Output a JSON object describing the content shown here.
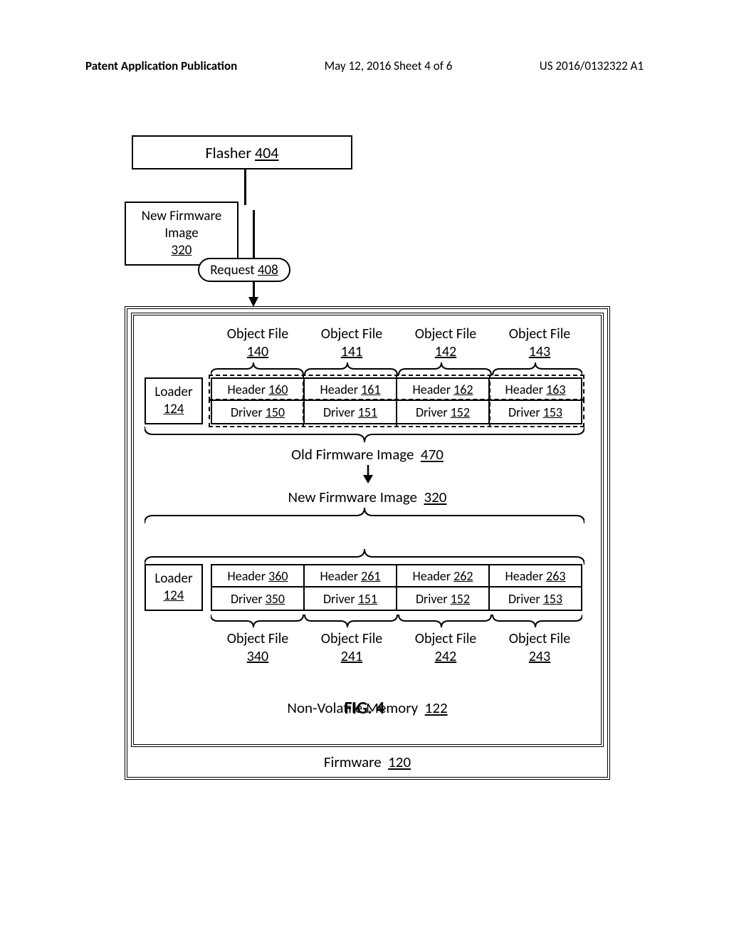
{
  "header": {
    "pub_type": "Patent Application Publication",
    "date_sheet": "May 12, 2016  Sheet 4 of 6",
    "pub_no": "US 2016/0132322 A1"
  },
  "figure_label": "FIG. 4",
  "flasher": {
    "name": "Flasher",
    "ref": "404"
  },
  "new_fw_box": {
    "line1": "New Firmware",
    "line2": "Image",
    "ref": "320"
  },
  "request": {
    "name": "Request",
    "ref": "408"
  },
  "firmware": {
    "name": "Firmware",
    "ref": "120"
  },
  "nvmem": {
    "name": "Non-Volatile Memory",
    "ref": "122"
  },
  "object_files_top": [
    {
      "label": "Object File",
      "ref": "140"
    },
    {
      "label": "Object File",
      "ref": "141"
    },
    {
      "label": "Object File",
      "ref": "142"
    },
    {
      "label": "Object File",
      "ref": "143"
    }
  ],
  "loader": {
    "name": "Loader",
    "ref": "124"
  },
  "old_table": {
    "headers": [
      {
        "label": "Header",
        "ref": "160"
      },
      {
        "label": "Header",
        "ref": "161"
      },
      {
        "label": "Header",
        "ref": "162"
      },
      {
        "label": "Header",
        "ref": "163"
      }
    ],
    "drivers": [
      {
        "label": "Driver",
        "ref": "150"
      },
      {
        "label": "Driver",
        "ref": "151"
      },
      {
        "label": "Driver",
        "ref": "152"
      },
      {
        "label": "Driver",
        "ref": "153"
      }
    ]
  },
  "old_image": {
    "name": "Old Firmware Image",
    "ref": "470"
  },
  "new_image": {
    "name": "New Firmware Image",
    "ref": "320"
  },
  "new_table": {
    "headers": [
      {
        "label": "Header",
        "ref": "360"
      },
      {
        "label": "Header",
        "ref": "261"
      },
      {
        "label": "Header",
        "ref": "262"
      },
      {
        "label": "Header",
        "ref": "263"
      }
    ],
    "drivers": [
      {
        "label": "Driver",
        "ref": "350"
      },
      {
        "label": "Driver",
        "ref": "151"
      },
      {
        "label": "Driver",
        "ref": "152"
      },
      {
        "label": "Driver",
        "ref": "153"
      }
    ]
  },
  "object_files_bot": [
    {
      "label": "Object File",
      "ref": "340"
    },
    {
      "label": "Object File",
      "ref": "241"
    },
    {
      "label": "Object File",
      "ref": "242"
    },
    {
      "label": "Object File",
      "ref": "243"
    }
  ]
}
